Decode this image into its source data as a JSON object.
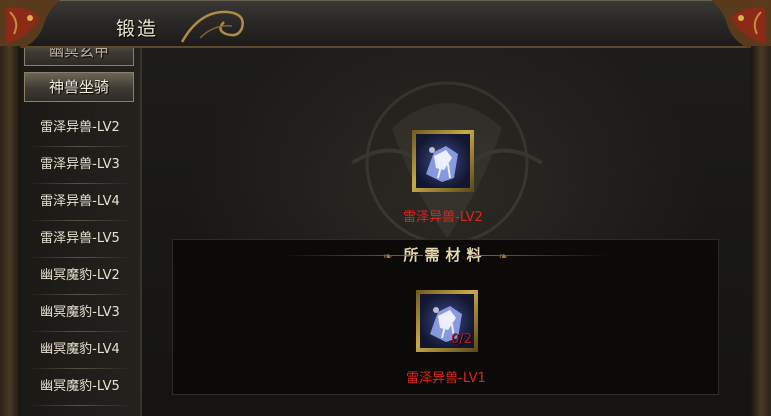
{
  "window": {
    "title": "锻造"
  },
  "sidebar": {
    "categories": [
      {
        "label": "幽冥玄甲"
      },
      {
        "label": "神兽坐骑"
      }
    ],
    "items": [
      {
        "label": "雷泽异兽-LV2"
      },
      {
        "label": "雷泽异兽-LV3"
      },
      {
        "label": "雷泽异兽-LV4"
      },
      {
        "label": "雷泽异兽-LV5"
      },
      {
        "label": "幽冥魔豹-LV2"
      },
      {
        "label": "幽冥魔豹-LV3"
      },
      {
        "label": "幽冥魔豹-LV4"
      },
      {
        "label": "幽冥魔豹-LV5"
      }
    ]
  },
  "result": {
    "name": "雷泽异兽-LV2",
    "icon": "thunder-beast-icon"
  },
  "materials": {
    "title": "所需材料",
    "items": [
      {
        "name": "雷泽异兽-LV1",
        "count": "0/2",
        "icon": "thunder-beast-icon"
      }
    ]
  },
  "colors": {
    "item_name": "#e0251b",
    "count": "#c8151a",
    "slot_gold": "#c9a84a"
  }
}
